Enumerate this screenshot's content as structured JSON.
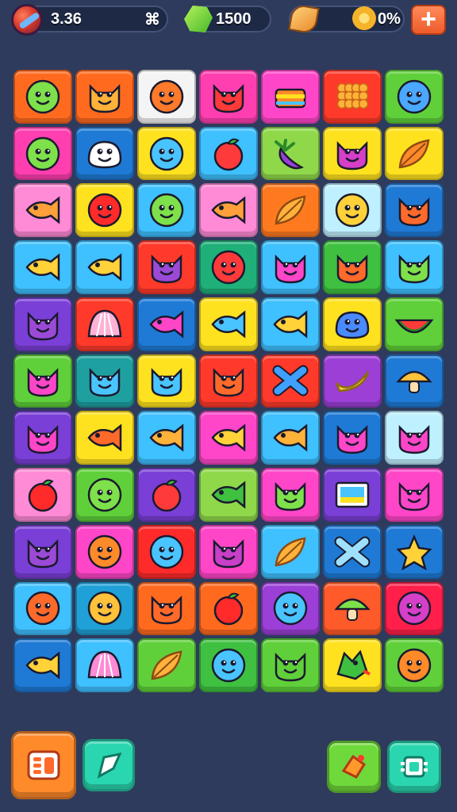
{
  "hud": {
    "coins": "3.36",
    "coins_suffix": "⌘",
    "gems": "1500",
    "progress": "0%"
  },
  "board": {
    "tiles": [
      {
        "bg": "#ff6a1f",
        "icon": "face",
        "color": "#7ee04a"
      },
      {
        "bg": "#ff6a1f",
        "icon": "cat",
        "color": "#ffb23a"
      },
      {
        "bg": "#f4f4f4",
        "icon": "face",
        "color": "#ff7a2a"
      },
      {
        "bg": "#ff3fb0",
        "icon": "cat",
        "color": "#ff3a3a"
      },
      {
        "bg": "#ff46c8",
        "icon": "cake",
        "color": "#ff8a2a"
      },
      {
        "bg": "#ff3a2a",
        "icon": "berry",
        "color": "#ffb23a"
      },
      {
        "bg": "#5fd03a",
        "icon": "face",
        "color": "#4aa8ff"
      },
      {
        "bg": "#ff3fb0",
        "icon": "face",
        "color": "#7ee04a"
      },
      {
        "bg": "#1f7ad6",
        "icon": "blob",
        "color": "#ffffff"
      },
      {
        "bg": "#ffe21f",
        "icon": "face",
        "color": "#4ac4ff"
      },
      {
        "bg": "#3fc0ff",
        "icon": "apple",
        "color": "#ff3a3a"
      },
      {
        "bg": "#8fd84a",
        "icon": "eggplant",
        "color": "#9b3fd6"
      },
      {
        "bg": "#ffe21f",
        "icon": "cat",
        "color": "#d63fc8"
      },
      {
        "bg": "#ffe21f",
        "icon": "leaf",
        "color": "#ff8a2a"
      },
      {
        "bg": "#ff8ad6",
        "icon": "fish",
        "color": "#ffa03a"
      },
      {
        "bg": "#ffe21f",
        "icon": "face",
        "color": "#ff2a2a"
      },
      {
        "bg": "#3fc0ff",
        "icon": "face",
        "color": "#7ee04a"
      },
      {
        "bg": "#ff8ad6",
        "icon": "fish",
        "color": "#ffa03a"
      },
      {
        "bg": "#ff7a1f",
        "icon": "leaf",
        "color": "#ffb23a"
      },
      {
        "bg": "#bff0ff",
        "icon": "face",
        "color": "#ffd23a"
      },
      {
        "bg": "#1f7ad6",
        "icon": "cat",
        "color": "#ff6a2a"
      },
      {
        "bg": "#3fc0ff",
        "icon": "fish",
        "color": "#ffd23a"
      },
      {
        "bg": "#3fc0ff",
        "icon": "fish",
        "color": "#ffd23a"
      },
      {
        "bg": "#ff3a2a",
        "icon": "cat",
        "color": "#9b4ad6"
      },
      {
        "bg": "#1fb07a",
        "icon": "face",
        "color": "#ff3a3a"
      },
      {
        "bg": "#3fc0ff",
        "icon": "cat",
        "color": "#ff46c8"
      },
      {
        "bg": "#3fc040",
        "icon": "cat",
        "color": "#ff6a2a"
      },
      {
        "bg": "#3fc0ff",
        "icon": "cat",
        "color": "#7ee04a"
      },
      {
        "bg": "#7a3fd6",
        "icon": "cat",
        "color": "#9b4ad6"
      },
      {
        "bg": "#ff3a2a",
        "icon": "shell",
        "color": "#ffb2d6"
      },
      {
        "bg": "#1f7ad6",
        "icon": "fish",
        "color": "#ff46c8"
      },
      {
        "bg": "#ffe21f",
        "icon": "fish",
        "color": "#4ac4ff"
      },
      {
        "bg": "#3fc0ff",
        "icon": "fish",
        "color": "#ffd23a"
      },
      {
        "bg": "#ffe21f",
        "icon": "blob",
        "color": "#4a8aff"
      },
      {
        "bg": "#5fd03a",
        "icon": "watermelon",
        "color": "#ff3a3a"
      },
      {
        "bg": "#5fd03a",
        "icon": "cat",
        "color": "#ff46c8"
      },
      {
        "bg": "#1fa0a0",
        "icon": "cat",
        "color": "#4ac4ff"
      },
      {
        "bg": "#ffe21f",
        "icon": "cat",
        "color": "#4ac4ff"
      },
      {
        "bg": "#ff3a2a",
        "icon": "cat",
        "color": "#ff6a2a"
      },
      {
        "bg": "#ff3a2a",
        "icon": "x",
        "color": "#3fa0ff"
      },
      {
        "bg": "#9b3fd6",
        "icon": "banana",
        "color": "#ffd23a"
      },
      {
        "bg": "#1f7ad6",
        "icon": "mushroom",
        "color": "#ffc23a"
      },
      {
        "bg": "#7a3fd6",
        "icon": "cat",
        "color": "#ff46c8"
      },
      {
        "bg": "#ffe21f",
        "icon": "fish",
        "color": "#ff6a2a"
      },
      {
        "bg": "#3fc0ff",
        "icon": "fish",
        "color": "#ffb23a"
      },
      {
        "bg": "#ff46c8",
        "icon": "fish",
        "color": "#ffd23a"
      },
      {
        "bg": "#3fc0ff",
        "icon": "fish",
        "color": "#ffb23a"
      },
      {
        "bg": "#1f7ad6",
        "icon": "cat",
        "color": "#ff46c8"
      },
      {
        "bg": "#bff0ff",
        "icon": "cat",
        "color": "#ff46c8"
      },
      {
        "bg": "#ff8ad6",
        "icon": "apple",
        "color": "#ff2a2a"
      },
      {
        "bg": "#5fd03a",
        "icon": "face",
        "color": "#7ee04a"
      },
      {
        "bg": "#7a3fd6",
        "icon": "apple",
        "color": "#ff3a3a"
      },
      {
        "bg": "#8fd84a",
        "icon": "fish",
        "color": "#3fc040"
      },
      {
        "bg": "#ff46c8",
        "icon": "cat",
        "color": "#7ee04a"
      },
      {
        "bg": "#7a3fd6",
        "icon": "card",
        "color": "#4ac4ff"
      },
      {
        "bg": "#ff46c8",
        "icon": "cat",
        "color": "#ff46c8"
      },
      {
        "bg": "#7a3fd6",
        "icon": "cat",
        "color": "#9b4ad6"
      },
      {
        "bg": "#ff46c8",
        "icon": "face",
        "color": "#ff8a2a"
      },
      {
        "bg": "#ff2a2a",
        "icon": "face",
        "color": "#4ac4ff"
      },
      {
        "bg": "#ff46c8",
        "icon": "cat",
        "color": "#c83fc8"
      },
      {
        "bg": "#3fc0ff",
        "icon": "leaf",
        "color": "#ffb23a"
      },
      {
        "bg": "#1f7ad6",
        "icon": "x",
        "color": "#9fe0ff"
      },
      {
        "bg": "#1f7ad6",
        "icon": "star",
        "color": "#ffd23a"
      },
      {
        "bg": "#3fc0ff",
        "icon": "face",
        "color": "#ff6a2a"
      },
      {
        "bg": "#1fa0d6",
        "icon": "face",
        "color": "#ffc23a"
      },
      {
        "bg": "#ff6a1f",
        "icon": "cat",
        "color": "#ff6a2a"
      },
      {
        "bg": "#ff6a1f",
        "icon": "apple",
        "color": "#ff2a2a"
      },
      {
        "bg": "#9b3fd6",
        "icon": "face",
        "color": "#4ac4ff"
      },
      {
        "bg": "#ff5a2a",
        "icon": "mushroom",
        "color": "#7ee04a"
      },
      {
        "bg": "#ff1f4a",
        "icon": "face",
        "color": "#d63fc8"
      },
      {
        "bg": "#1f7ad6",
        "icon": "fish",
        "color": "#ffd23a"
      },
      {
        "bg": "#3fc0ff",
        "icon": "shell",
        "color": "#ff8ad6"
      },
      {
        "bg": "#5fd03a",
        "icon": "leaf",
        "color": "#ffb23a"
      },
      {
        "bg": "#3fc040",
        "icon": "face",
        "color": "#4ac4ff"
      },
      {
        "bg": "#5fd03a",
        "icon": "cat",
        "color": "#5fd03a"
      },
      {
        "bg": "#ffe21f",
        "icon": "dragon",
        "color": "#3fc040"
      },
      {
        "bg": "#5fd03a",
        "icon": "face",
        "color": "#ff8a2a"
      }
    ]
  },
  "controls": {
    "menu": {
      "bg": "#ff8a2a",
      "icon": "menu-icon"
    },
    "hint": {
      "bg": "#2ad6b0",
      "icon": "cursor-icon"
    },
    "boost": {
      "bg": "#6fd83a",
      "icon": "bell-icon"
    },
    "shuffle": {
      "bg": "#2ad6b0",
      "icon": "chip-icon"
    }
  }
}
